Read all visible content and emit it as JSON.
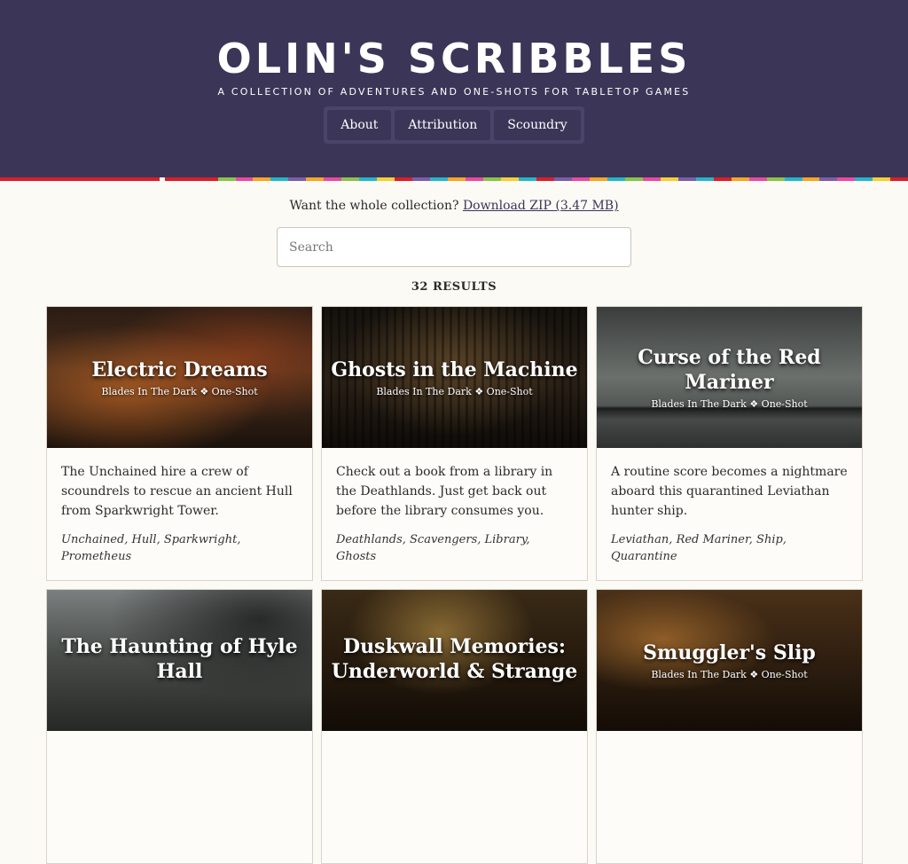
{
  "header": {
    "title": "Olin's Scribbles",
    "tagline": "A collection of adventures and one-shots for tabletop games",
    "nav": [
      {
        "label": "About"
      },
      {
        "label": "Attribution"
      },
      {
        "label": "Scoundry"
      }
    ]
  },
  "collection": {
    "prompt": "Want the whole collection?",
    "download_label": "Download ZIP (3.47 MB)"
  },
  "search": {
    "placeholder": "Search",
    "value": ""
  },
  "results": {
    "count_label": "32 RESULTS"
  },
  "cards": [
    {
      "title": "Electric Dreams",
      "subtitle": "Blades In The Dark ❖ One-Shot",
      "description": "The Unchained hire a crew of scoundrels to rescue an ancient Hull from Sparkwright Tower.",
      "tags": "Unchained, Hull, Sparkwright, Prometheus"
    },
    {
      "title": "Ghosts in the Machine",
      "subtitle": "Blades In The Dark ❖ One-Shot",
      "description": "Check out a book from a library in the Deathlands. Just get back out before the library consumes you.",
      "tags": "Deathlands, Scavengers, Library, Ghosts"
    },
    {
      "title": "Curse of the Red Mariner",
      "subtitle": "Blades In The Dark ❖ One-Shot",
      "description": "A routine score becomes a nightmare aboard this quarantined Leviathan hunter ship.",
      "tags": "Leviathan, Red Mariner, Ship, Quarantine"
    },
    {
      "title": "The Haunting of Hyle Hall",
      "subtitle": "",
      "description": "",
      "tags": ""
    },
    {
      "title": "Duskwall Memories: Underworld & Strange",
      "subtitle": "",
      "description": "",
      "tags": ""
    },
    {
      "title": "Smuggler's Slip",
      "subtitle": "Blades In The Dark ❖ One-Shot",
      "description": "",
      "tags": ""
    }
  ],
  "colors": {
    "header_bg": "#3b3558",
    "page_bg": "#fbfaf5",
    "link": "#3b3558"
  }
}
